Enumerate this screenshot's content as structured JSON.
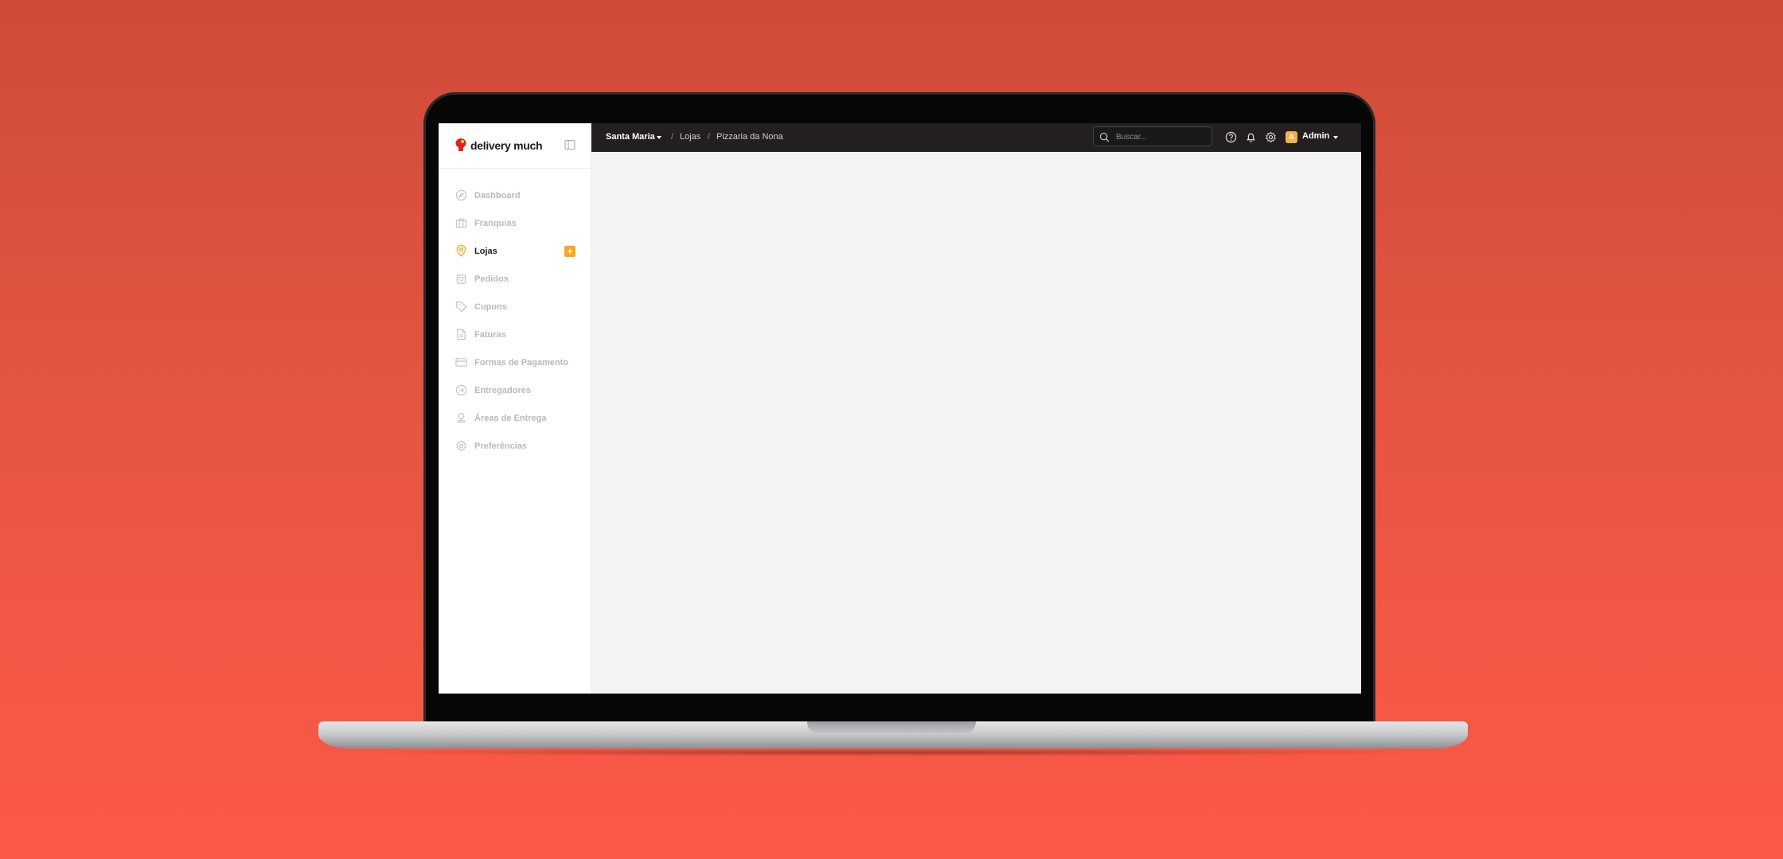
{
  "brand": {
    "name": "delivery much",
    "accent": "#f5a623",
    "logo_color": "#e0231b"
  },
  "sidebar": {
    "items": [
      {
        "label": "Dashboard",
        "icon": "compass-icon",
        "active": false
      },
      {
        "label": "Franquias",
        "icon": "briefcase-icon",
        "active": false
      },
      {
        "label": "Lojas",
        "icon": "map-pin-icon",
        "active": true,
        "action": "+"
      },
      {
        "label": "Pedidos",
        "icon": "shopping-bag-icon",
        "active": false
      },
      {
        "label": "Cupons",
        "icon": "tag-icon",
        "active": false
      },
      {
        "label": "Faturas",
        "icon": "file-icon",
        "active": false
      },
      {
        "label": "Formas de Pagamento",
        "icon": "credit-card-icon",
        "active": false
      },
      {
        "label": "Entregadores",
        "icon": "delivery-icon",
        "active": false
      },
      {
        "label": "Áreas de Entrega",
        "icon": "area-pin-icon",
        "active": false
      },
      {
        "label": "Preferências",
        "icon": "gear-icon",
        "active": false
      }
    ]
  },
  "topbar": {
    "city": "Santa Maria",
    "separator": "/",
    "breadcrumb_section": "Lojas",
    "breadcrumb_page": "Pizzaria da Nona",
    "search_placeholder": "Buscar...",
    "user_initial": "A",
    "user_name": "Admin"
  }
}
